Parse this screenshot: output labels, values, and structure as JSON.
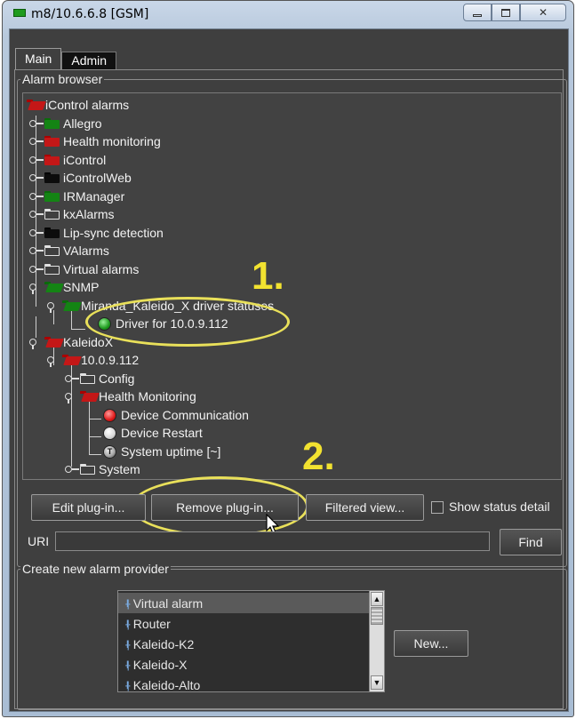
{
  "window": {
    "title": "m8/10.6.6.8 [GSM]"
  },
  "tabs": [
    {
      "label": "Main",
      "active": true
    },
    {
      "label": "Admin",
      "active": false
    }
  ],
  "alarm_browser": {
    "legend": "Alarm browser",
    "tree": [
      {
        "label": "iControl alarms",
        "icon": "folder-red-open-icon"
      },
      {
        "label": "Allegro",
        "icon": "folder-green-icon"
      },
      {
        "label": "Health monitoring",
        "icon": "folder-red-icon"
      },
      {
        "label": "iControl",
        "icon": "folder-red-icon"
      },
      {
        "label": "iControlWeb",
        "icon": "folder-black-icon"
      },
      {
        "label": "IRManager",
        "icon": "folder-green-icon"
      },
      {
        "label": "kxAlarms",
        "icon": "folder-white-icon"
      },
      {
        "label": "Lip-sync detection",
        "icon": "folder-black-icon"
      },
      {
        "label": "VAlarms",
        "icon": "folder-white-icon"
      },
      {
        "label": "Virtual alarms",
        "icon": "folder-white-icon"
      },
      {
        "label": "SNMP",
        "icon": "folder-green-open-icon"
      },
      {
        "label": "Miranda_Kaleido_X driver statuses",
        "icon": "folder-green-open-icon"
      },
      {
        "label": "Driver for 10.0.9.112",
        "icon": "status-green-icon"
      },
      {
        "label": "KaleidoX",
        "icon": "folder-red-open-icon"
      },
      {
        "label": "10.0.9.112",
        "icon": "folder-red-open-icon"
      },
      {
        "label": "Config",
        "icon": "folder-white-icon"
      },
      {
        "label": "Health Monitoring",
        "icon": "folder-red-open-icon"
      },
      {
        "label": "Device Communication",
        "icon": "status-red-icon"
      },
      {
        "label": "Device Restart",
        "icon": "status-white-icon"
      },
      {
        "label": "System uptime [~]",
        "icon": "status-timer-icon"
      },
      {
        "label": "System",
        "icon": "folder-white-icon"
      }
    ]
  },
  "annotations": {
    "step1": "1.",
    "step2": "2."
  },
  "actions": {
    "edit_plugin": "Edit plug-in...",
    "remove_plugin": "Remove plug-in...",
    "filtered_view": "Filtered view...",
    "show_status_detail": "Show status detail",
    "show_status_detail_checked": false
  },
  "uri": {
    "label": "URI",
    "value": "",
    "find": "Find"
  },
  "create_provider": {
    "legend": "Create new alarm provider",
    "items": [
      "Virtual alarm",
      "Router",
      "Kaleido-K2",
      "Kaleido-X",
      "Kaleido-Alto"
    ],
    "selected": "Virtual alarm",
    "new_button": "New..."
  }
}
